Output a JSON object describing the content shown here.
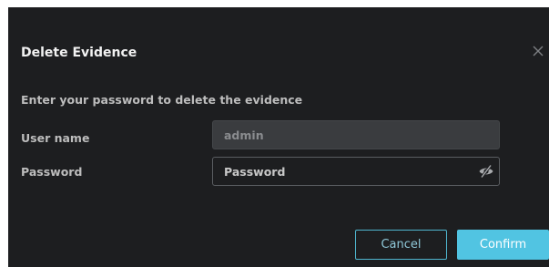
{
  "dialog": {
    "title": "Delete Evidence",
    "prompt": "Enter your password to delete the evidence"
  },
  "form": {
    "username_label": "User name",
    "username_value": "admin",
    "password_label": "Password",
    "password_placeholder": "Password",
    "password_value": ""
  },
  "buttons": {
    "cancel": "Cancel",
    "confirm": "Confirm"
  },
  "icons": {
    "close": "close-icon",
    "password_visibility": "eye-slash-icon"
  },
  "colors": {
    "dialog_bg": "#1d1e20",
    "accent": "#51c4e2"
  }
}
